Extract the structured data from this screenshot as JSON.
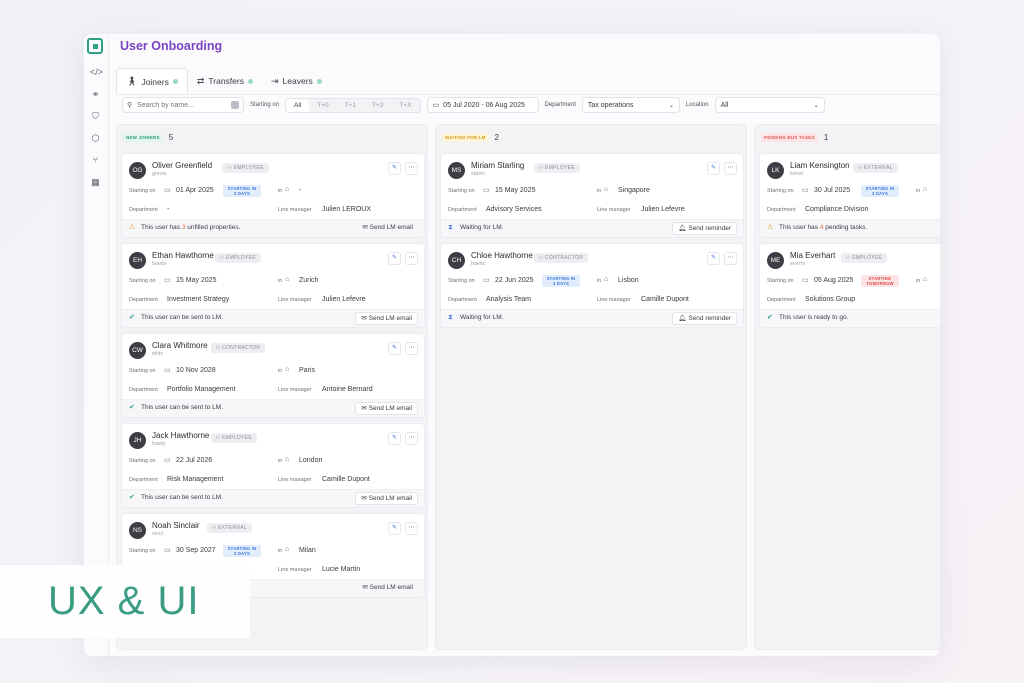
{
  "app": {
    "title": "User Onboarding"
  },
  "rail_icons": [
    "code-icon",
    "share-icon",
    "shield-icon",
    "box-icon",
    "branch-icon",
    "grid-icon"
  ],
  "tabs": [
    {
      "label": "Joiners",
      "icon": "person-icon"
    },
    {
      "label": "Transfers",
      "icon": "transfer-icon"
    },
    {
      "label": "Leavers",
      "icon": "exit-icon"
    }
  ],
  "filters": {
    "search_placeholder": "Search by name...",
    "starting_on_label": "Starting on",
    "starting_options": [
      "All",
      "T+0",
      "T+1",
      "T+2",
      "T+X"
    ],
    "date_range": "05 Jul 2020 - 06 Aug 2025",
    "department_label": "Department",
    "department_value": "Tax operations",
    "location_label": "Location",
    "location_value": "All"
  },
  "labels": {
    "starting_on": "Starting on",
    "in": "in",
    "department": "Department",
    "line_manager": "Line manager"
  },
  "columns": [
    {
      "chip": "NEW JOINERS",
      "count": "5",
      "chip_bg": "#e3f5ee",
      "chip_fg": "#2ea084",
      "cards": [
        {
          "initials": "OG",
          "name": "Oliver Greenfield",
          "handle": "grews",
          "type": "EMPLOYEE",
          "start": "01 Apr 2025",
          "badge": "STARTING IN 3 DAYS",
          "badge_color": "blue",
          "location": "-",
          "department": "-",
          "manager": "Julien LEROUX",
          "footer_icon": "warning",
          "footer_pre": "This user has ",
          "footer_num": "3",
          "footer_post": " unfilled properties.",
          "footer_btn": "Send LM email",
          "footer_btn_boxed": false
        },
        {
          "initials": "EH",
          "name": "Ethan Hawthorne",
          "handle": "hawte",
          "type": "EMPLOYEE",
          "start": "15 May 2025",
          "badge": "",
          "badge_color": "",
          "location": "Zurich",
          "department": "Investment Strategy",
          "manager": "Julien Lefevre",
          "footer_icon": "ok",
          "footer_pre": "This user can be sent to LM.",
          "footer_num": "",
          "footer_post": "",
          "footer_btn": "Send LM email",
          "footer_btn_boxed": true
        },
        {
          "initials": "CW",
          "name": "Clara Whitmore",
          "handle": "whtc",
          "type": "CONTRACTOR",
          "start": "10 Nov 2028",
          "badge": "",
          "badge_color": "",
          "location": "Paris",
          "department": "Portfolio Management",
          "manager": "Antoine Bernard",
          "footer_icon": "ok",
          "footer_pre": "This user can be sent to LM.",
          "footer_num": "",
          "footer_post": "",
          "footer_btn": "Send LM email",
          "footer_btn_boxed": true
        },
        {
          "initials": "JH",
          "name": "Jack Hawthorne",
          "handle": "hawtj",
          "type": "EMPLOYEE",
          "start": "22 Jul 2026",
          "badge": "",
          "badge_color": "",
          "location": "London",
          "department": "Risk Management",
          "manager": "Camille Dupont",
          "footer_icon": "ok",
          "footer_pre": "This user can be sent to LM.",
          "footer_num": "",
          "footer_post": "",
          "footer_btn": "Send LM email",
          "footer_btn_boxed": true
        },
        {
          "initials": "NS",
          "name": "Noah Sinclair",
          "handle": "sincl",
          "type": "EXTERNAL",
          "start": "30 Sep 2027",
          "badge": "STARTING IN 3 DAYS",
          "badge_color": "blue",
          "location": "Milan",
          "department": "",
          "manager": "Lucie Martin",
          "footer_icon": "",
          "footer_pre": "",
          "footer_num": "",
          "footer_post": "",
          "footer_btn": "Send LM email",
          "footer_btn_boxed": false
        }
      ]
    },
    {
      "chip": "WAITING FOR LM",
      "count": "2",
      "chip_bg": "#fdf3d9",
      "chip_fg": "#d49a0e",
      "cards": [
        {
          "initials": "MS",
          "name": "Miriam Starling",
          "handle": "starm",
          "type": "EMPLOYEE",
          "start": "15 May 2025",
          "badge": "",
          "badge_color": "",
          "location": "Singapore",
          "department": "Advisory Services",
          "manager": "Julien Lefevre",
          "footer_icon": "wait",
          "footer_pre": "Waiting for LM.",
          "footer_num": "",
          "footer_post": "",
          "footer_btn": "Send reminder",
          "footer_btn_boxed": true
        },
        {
          "initials": "CH",
          "name": "Chloe Hawthorne",
          "handle": "hawtc",
          "type": "CONTRACTOR",
          "start": "22 Jun 2025",
          "badge": "STARTING IN 3 DAYS",
          "badge_color": "blue",
          "location": "Lisbon",
          "department": "Analysis Team",
          "manager": "Camille Dupont",
          "footer_icon": "wait",
          "footer_pre": "Waiting for LM.",
          "footer_num": "",
          "footer_post": "",
          "footer_btn": "Send reminder",
          "footer_btn_boxed": true
        }
      ]
    },
    {
      "chip": "PENDING BUS TASKS",
      "count": "1",
      "chip_bg": "#fde5e5",
      "chip_fg": "#e05858",
      "cards": [
        {
          "initials": "LK",
          "name": "Liam Kensington",
          "handle": "kensl",
          "type": "EXTERNAL",
          "start": "30 Jul 2025",
          "badge": "STARTING IN 3 DAYS",
          "badge_color": "blue",
          "location": "",
          "department": "Compliance Division",
          "manager": "",
          "footer_icon": "warning",
          "footer_pre": "This user has ",
          "footer_num": "4",
          "footer_post": " pending tasks.",
          "footer_btn": "",
          "footer_btn_boxed": false
        },
        {
          "initials": "ME",
          "name": "Mia Everhart",
          "handle": "everm",
          "type": "EMPLOYEE",
          "start": "05 Aug 2025",
          "badge": "STARTING TOMORROW",
          "badge_color": "red",
          "location": "",
          "department": "Solutions Group",
          "manager": "",
          "footer_icon": "ok",
          "footer_pre": "This user is ready to go.",
          "footer_num": "",
          "footer_post": "",
          "footer_btn": "",
          "footer_btn_boxed": false
        }
      ]
    }
  ],
  "banner": {
    "text": "UX & UI",
    "color": "#3a9c82"
  }
}
